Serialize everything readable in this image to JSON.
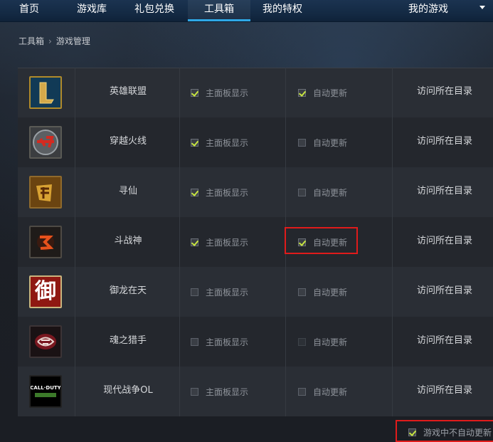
{
  "nav": {
    "items": [
      {
        "label": "首页",
        "active": false
      },
      {
        "label": "游戏库",
        "active": false
      },
      {
        "label": "礼包兑换",
        "active": false
      },
      {
        "label": "工具箱",
        "active": true
      },
      {
        "label": "我的特权",
        "active": false
      }
    ],
    "right_label": "我的游戏",
    "accent": "#2fa8e6"
  },
  "breadcrumb": {
    "root": "工具箱",
    "current": "游戏管理"
  },
  "columns": {
    "main_panel": "主面板显示",
    "auto_update": "自动更新",
    "visit": "访问所在目录"
  },
  "games": [
    {
      "name": "英雄联盟",
      "icon": "lol-icon",
      "main_panel": true,
      "auto_update": true
    },
    {
      "name": "穿越火线",
      "icon": "cf-icon",
      "main_panel": true,
      "auto_update": false
    },
    {
      "name": "寻仙",
      "icon": "xunxian-icon",
      "main_panel": true,
      "auto_update": false
    },
    {
      "name": "斗战神",
      "icon": "douzhanshen-icon",
      "main_panel": true,
      "auto_update": true
    },
    {
      "name": "御龙在天",
      "icon": "yulong-icon",
      "main_panel": false,
      "auto_update": false
    },
    {
      "name": "魂之猎手",
      "icon": "hunzhilieshou-icon",
      "main_panel": false,
      "auto_update": false
    },
    {
      "name": "现代战争OL",
      "icon": "callofduty-icon",
      "main_panel": false,
      "auto_update": false
    }
  ],
  "footer": {
    "no_auto_update_label": "游戏中不自动更新",
    "checked": true
  },
  "icon_text": {
    "yulong": "御",
    "cod": "CALL·DUTY"
  },
  "highlight_color": "#e01b1b"
}
